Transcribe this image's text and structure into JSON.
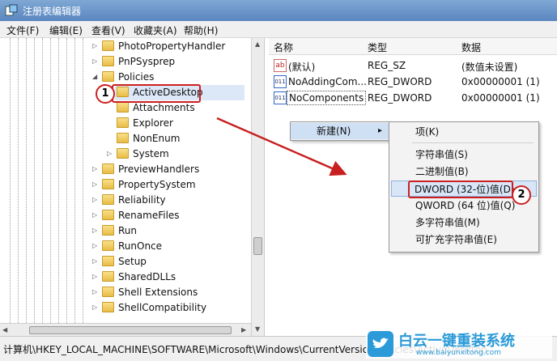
{
  "window": {
    "title": "注册表编辑器"
  },
  "menu": [
    "文件(F)",
    "编辑(E)",
    "查看(V)",
    "收藏夹(A)",
    "帮助(H)"
  ],
  "tree": {
    "items": [
      {
        "label": "PhotoPropertyHandler",
        "expander": "▷"
      },
      {
        "label": "PnPSysprep",
        "expander": "▷"
      },
      {
        "label": "Policies",
        "expander": "◢"
      },
      {
        "label": "ActiveDesktop",
        "expander": ""
      },
      {
        "label": "Attachments",
        "expander": ""
      },
      {
        "label": "Explorer",
        "expander": ""
      },
      {
        "label": "NonEnum",
        "expander": ""
      },
      {
        "label": "System",
        "expander": "▷"
      },
      {
        "label": "PreviewHandlers",
        "expander": "▷"
      },
      {
        "label": "PropertySystem",
        "expander": "▷"
      },
      {
        "label": "Reliability",
        "expander": "▷"
      },
      {
        "label": "RenameFiles",
        "expander": "▷"
      },
      {
        "label": "Run",
        "expander": "▷"
      },
      {
        "label": "RunOnce",
        "expander": "▷"
      },
      {
        "label": "Setup",
        "expander": "▷"
      },
      {
        "label": "SharedDLLs",
        "expander": "▷"
      },
      {
        "label": "Shell Extensions",
        "expander": "▷"
      },
      {
        "label": "ShellCompatibility",
        "expander": "▷"
      }
    ]
  },
  "values": {
    "headers": {
      "name": "名称",
      "type": "类型",
      "data": "数据"
    },
    "rows": [
      {
        "icon": "ab",
        "name": "(默认)",
        "type": "REG_SZ",
        "data": "(数值未设置)"
      },
      {
        "icon": "011",
        "name": "NoAddingCom...",
        "type": "REG_DWORD",
        "data": "0x00000001 (1)"
      },
      {
        "icon": "011",
        "name": "NoComponents",
        "type": "REG_DWORD",
        "data": "0x00000001 (1)"
      }
    ]
  },
  "context_menu": {
    "new_label": "新建(N)",
    "new_arrow": "▸",
    "submenu": [
      "项(K)",
      "字符串值(S)",
      "二进制值(B)",
      "DWORD (32-位)值(D)",
      "QWORD (64 位)值(Q)",
      "多字符串值(M)",
      "可扩充字符串值(E)"
    ]
  },
  "status": {
    "path": "计算机\\HKEY_LOCAL_MACHINE\\SOFTWARE\\Microsoft\\Windows\\CurrentVersion\\Policies\\ActiveDesktop"
  },
  "annotations": {
    "step1": "1",
    "step2": "2"
  },
  "watermark": {
    "text": "白云一键重装系统",
    "url": "www.baiyunxitong.com"
  },
  "colors": {
    "accent": "#cc2020",
    "titlebar": "#5a86c0",
    "selection": "#dce8f8",
    "watermark": "#2a9ad8"
  }
}
